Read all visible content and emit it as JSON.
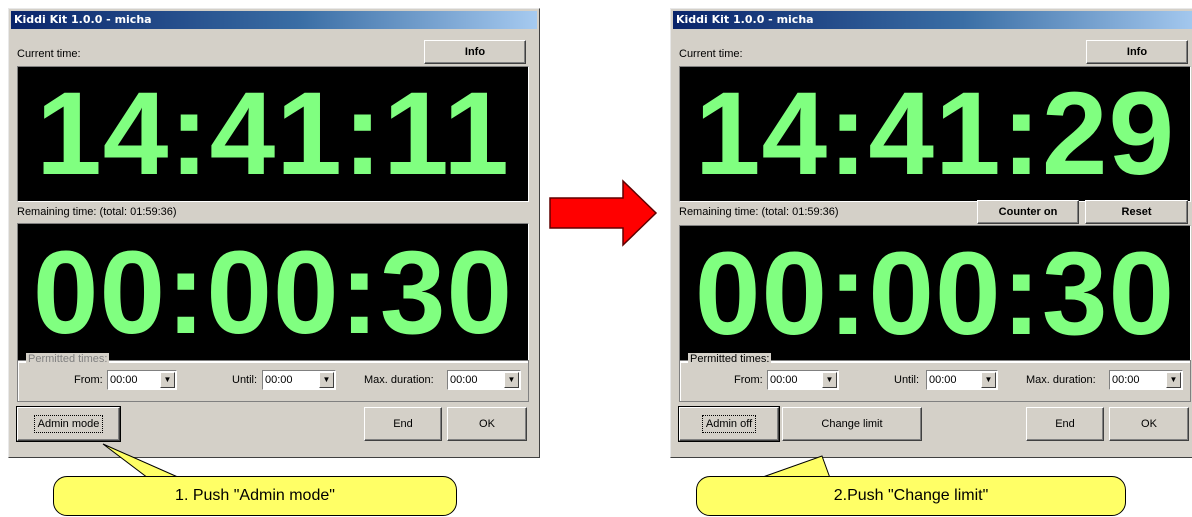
{
  "left": {
    "title": "Kiddi Kit 1.0.0 - micha",
    "current_time_label": "Current time:",
    "info_button": "Info",
    "current_time": "14:41:11",
    "remaining_label": "Remaining time: (total: 01:59:36)",
    "remaining_time": "00:00:30",
    "permitted_title": "Permitted times:",
    "from_label": "From:",
    "from_value": "00:00",
    "until_label": "Until:",
    "until_value": "00:00",
    "max_label": "Max. duration:",
    "max_value": "00:00",
    "admin_button": "Admin mode",
    "end_button": "End",
    "ok_button": "OK"
  },
  "right": {
    "title": "Kiddi Kit 1.0.0 - micha",
    "current_time_label": "Current time:",
    "info_button": "Info",
    "current_time": "14:41:29",
    "remaining_label": "Remaining time: (total: 01:59:36)",
    "counter_button": "Counter on",
    "reset_button": "Reset",
    "remaining_time": "00:00:30",
    "permitted_title": "Permitted times:",
    "from_label": "From:",
    "from_value": "00:00",
    "until_label": "Until:",
    "until_value": "00:00",
    "max_label": "Max. duration:",
    "max_value": "00:00",
    "admin_button": "Admin off",
    "change_limit_button": "Change limit",
    "end_button": "End",
    "ok_button": "OK"
  },
  "callouts": {
    "step1": "1. Push  \"Admin mode\"",
    "step2": "2.Push  \"Change limit\""
  },
  "colors": {
    "digits": "#80ff80",
    "arrow": "#ff0000",
    "callout": "#ffff66",
    "window": "#d4d0c8"
  }
}
